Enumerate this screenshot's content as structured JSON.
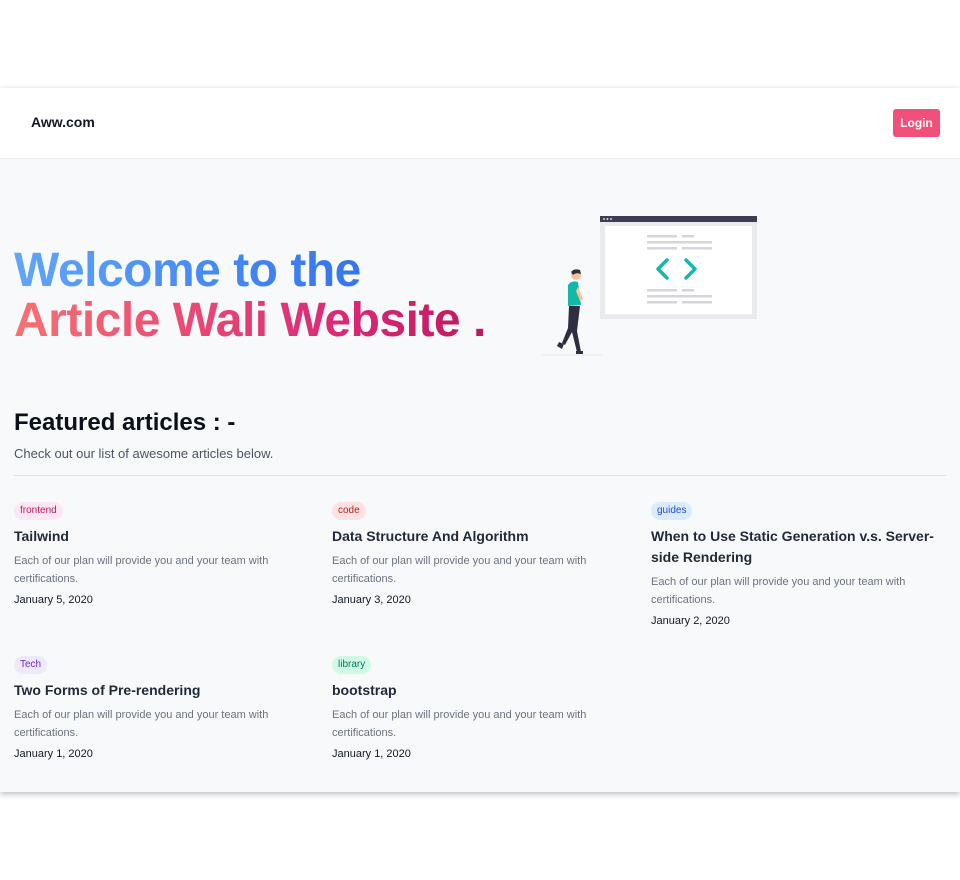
{
  "nav": {
    "brand": "Aww.com",
    "login_label": "Login"
  },
  "hero": {
    "line1": "Welcome to the",
    "line2": "Article Wali Website ."
  },
  "featured": {
    "title": "Featured articles : -",
    "subtitle": "Check out our list of awesome articles below."
  },
  "articles": [
    {
      "tag": "frontend",
      "tag_bg": "#fce7f3",
      "tag_color": "#be185d",
      "title": "Tailwind",
      "description": "Each of our plan will provide you and your team with certifications.",
      "date": "January 5, 2020"
    },
    {
      "tag": "code",
      "tag_bg": "#fee2e2",
      "tag_color": "#b91c1c",
      "title": "Data Structure And Algorithm",
      "description": "Each of our plan will provide you and your team with certifications.",
      "date": "January 3, 2020"
    },
    {
      "tag": "guides",
      "tag_bg": "#dbeafe",
      "tag_color": "#1d4ed8",
      "title": "When to Use Static Generation v.s. Server-side Rendering",
      "description": "Each of our plan will provide you and your team with certifications.",
      "date": "January 2, 2020"
    },
    {
      "tag": "Tech",
      "tag_bg": "#ede9fe",
      "tag_color": "#6d28d9",
      "title": "Two Forms of Pre-rendering",
      "description": "Each of our plan will provide you and your team with certifications.",
      "date": "January 1, 2020"
    },
    {
      "tag": "library",
      "tag_bg": "#d1fae5",
      "tag_color": "#047857",
      "title": "bootstrap",
      "description": "Each of our plan will provide you and your team with certifications.",
      "date": "January 1, 2020"
    }
  ],
  "illustration": {
    "icon": "code-window-illustration",
    "accent": "#14b8a6"
  }
}
